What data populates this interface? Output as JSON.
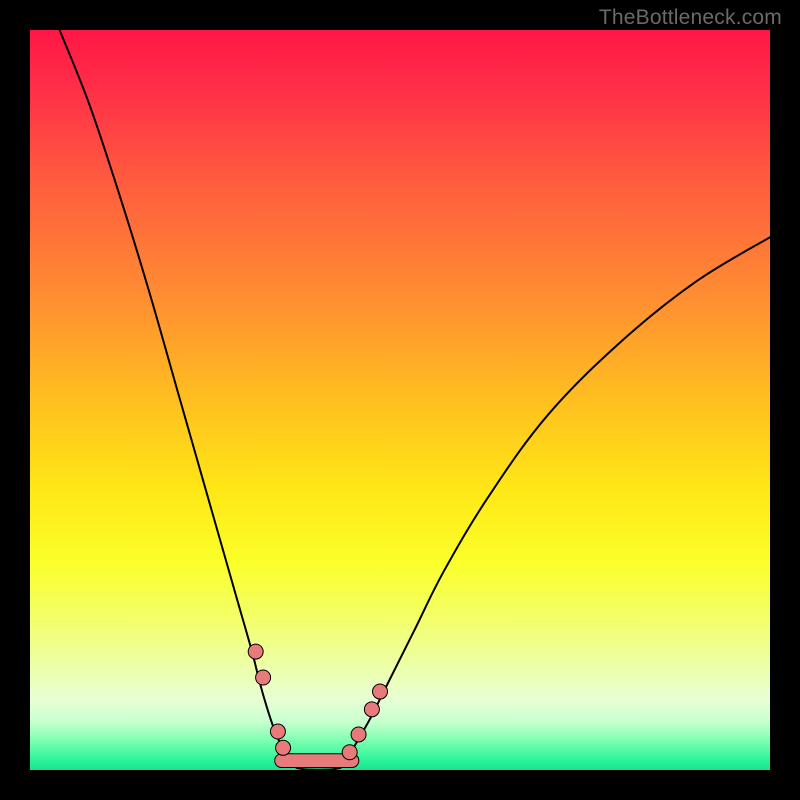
{
  "watermark": "TheBottleneck.com",
  "chart_data": {
    "type": "line",
    "title": "",
    "xlabel": "",
    "ylabel": "",
    "xlim": [
      0,
      100
    ],
    "ylim": [
      0,
      100
    ],
    "grid": false,
    "legend": false,
    "background_gradient_stops": [
      {
        "offset": 0.0,
        "color": "#ff1746"
      },
      {
        "offset": 0.08,
        "color": "#ff2f47"
      },
      {
        "offset": 0.2,
        "color": "#ff5a3f"
      },
      {
        "offset": 0.35,
        "color": "#ff8a33"
      },
      {
        "offset": 0.5,
        "color": "#ffbf20"
      },
      {
        "offset": 0.62,
        "color": "#ffe716"
      },
      {
        "offset": 0.72,
        "color": "#fbff2a"
      },
      {
        "offset": 0.8,
        "color": "#f3ff6e"
      },
      {
        "offset": 0.86,
        "color": "#ecffa8"
      },
      {
        "offset": 0.905,
        "color": "#e8ffd4"
      },
      {
        "offset": 0.935,
        "color": "#c8ffcf"
      },
      {
        "offset": 0.96,
        "color": "#7dffb0"
      },
      {
        "offset": 0.985,
        "color": "#30f59c"
      },
      {
        "offset": 1.0,
        "color": "#19e28e"
      }
    ],
    "series": [
      {
        "name": "left-branch-curve",
        "color": "#000000",
        "width": 2,
        "x": [
          4,
          8,
          12,
          16,
          20,
          22,
          24,
          26,
          28,
          30,
          31,
          32,
          33,
          34,
          35,
          36
        ],
        "y": [
          100,
          90,
          78,
          65,
          51,
          44,
          37,
          30,
          23,
          16,
          12,
          8.5,
          5.5,
          3.2,
          1.5,
          0.5
        ]
      },
      {
        "name": "right-branch-curve",
        "color": "#000000",
        "width": 2,
        "x": [
          42,
          43,
          44,
          46,
          48,
          52,
          56,
          62,
          70,
          80,
          90,
          100
        ],
        "y": [
          0.5,
          1.8,
          3.5,
          7,
          11,
          19,
          27,
          37,
          48,
          58,
          66,
          72
        ]
      },
      {
        "name": "joined-profile",
        "color": "#000000",
        "width": 2,
        "x": [
          36,
          37,
          38,
          39,
          40,
          41,
          42
        ],
        "y": [
          0.3,
          0.1,
          0.05,
          0.03,
          0.05,
          0.1,
          0.3
        ]
      }
    ],
    "markers": {
      "name": "data-beads",
      "color": "#e77a7a",
      "stroke": "#000000",
      "radius": 7.5,
      "points": [
        {
          "x": 30.5,
          "y": 16
        },
        {
          "x": 31.5,
          "y": 12.5
        },
        {
          "x": 33.5,
          "y": 5.2
        },
        {
          "x": 34.2,
          "y": 3.0
        },
        {
          "x": 43.2,
          "y": 2.4
        },
        {
          "x": 44.4,
          "y": 4.8
        },
        {
          "x": 46.2,
          "y": 8.2
        },
        {
          "x": 47.3,
          "y": 10.6
        }
      ]
    },
    "flat_band": {
      "name": "valley-band",
      "color": "#e77a7a",
      "stroke": "#000000",
      "y": 0.5,
      "x_start": 34.0,
      "x_end": 43.5,
      "thickness_y": 1.7
    }
  }
}
